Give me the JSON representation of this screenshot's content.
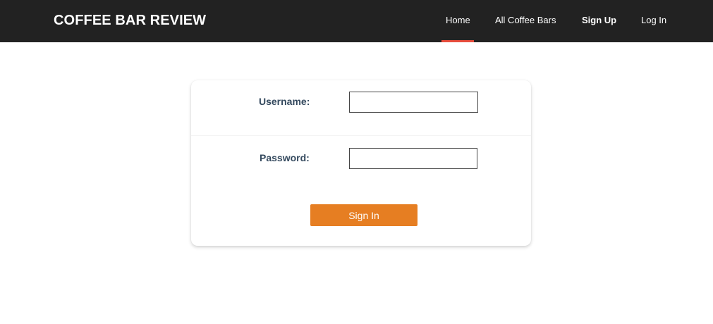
{
  "navbar": {
    "brand": "COFFEE BAR REVIEW",
    "links": [
      {
        "label": "Home",
        "active": true
      },
      {
        "label": "All Coffee Bars",
        "active": false
      },
      {
        "label": "Sign Up",
        "active": false
      },
      {
        "label": "Log In",
        "active": false
      }
    ],
    "background_color": "#222222",
    "active_indicator_color": "#e74c3c"
  },
  "login_form": {
    "username_label": "Username:",
    "username_value": "",
    "password_label": "Password:",
    "password_value": "",
    "submit_label": "Sign In",
    "label_color": "#34495e",
    "submit_color": "#e67e22"
  }
}
